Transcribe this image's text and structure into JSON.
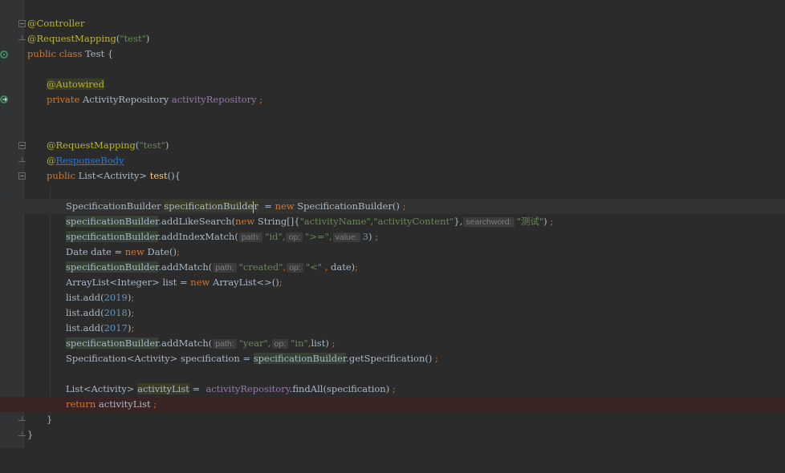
{
  "editor": {
    "lines": {
      "l1": "@Controller",
      "l2a": "@RequestMapping",
      "l2b": "(",
      "l2c": "\"test\"",
      "l2d": ")",
      "l3a": "public class ",
      "l3b": "Test {",
      "l5": "@Autowired",
      "l6a": "private ",
      "l6b": "ActivityRepository ",
      "l6c": "activityRepository",
      "l6d": " ;",
      "l9a": "@RequestMapping",
      "l9b": "(",
      "l9c": "\"test\"",
      "l9d": ")",
      "l10a": "@",
      "l10b": "ResponseBody",
      "l11a": "public ",
      "l11b": "List<Activity> ",
      "l11c": "test",
      "l11d": "(){",
      "l13a": "SpecificationBuilder ",
      "l13b": "specificationBuilde",
      "l13c": "r",
      "l13d": "  = ",
      "l13e": "new ",
      "l13f": "SpecificationBuilder() ",
      "l13g": ";",
      "l14a": "specificationBuilder",
      "l14b": ".addLikeSearch(",
      "l14c": "new ",
      "l14d": "String[]{",
      "l14e": "\"activityName\"",
      "l14f": ",",
      "l14g": "\"activityContent\"",
      "l14h": "},",
      "l14hint": "searchword:",
      "l14i": "\"测试\"",
      "l14j": ") ",
      "l14k": ";",
      "l15a": "specificationBuilder",
      "l15b": ".addIndexMatch(",
      "l15hint1": "path:",
      "l15c": "\"id\"",
      "l15d": ",",
      "l15hint2": "op:",
      "l15e": "\">=\"",
      "l15f": ",",
      "l15hint3": "value:",
      "l15g": "3",
      "l15h": ") ",
      "l15i": ";",
      "l16a": "Date date = ",
      "l16b": "new ",
      "l16c": "Date()",
      "l16d": ";",
      "l17a": "specificationBuilder",
      "l17b": ".addMatch(",
      "l17hint1": "path:",
      "l17c": "\"created\"",
      "l17d": ",",
      "l17hint2": "op:",
      "l17e": "\"<\"",
      "l17f": " , ",
      "l17g": "date)",
      "l17h": ";",
      "l18a": "ArrayList<Integer> list = ",
      "l18b": "new ",
      "l18c": "ArrayList<>()",
      "l18d": ";",
      "l19a": "list.add(",
      "l19b": "2019",
      "l19c": ")",
      "l19d": ";",
      "l20a": "list.add(",
      "l20b": "2018",
      "l20c": ")",
      "l20d": ";",
      "l21a": "list.add(",
      "l21b": "2017",
      "l21c": ")",
      "l21d": ";",
      "l22a": "specificationBuilder",
      "l22b": ".addMatch(",
      "l22hint1": "path:",
      "l22c": "\"year\"",
      "l22d": ",",
      "l22hint2": "op:",
      "l22e": "\"in\"",
      "l22f": ",",
      "l22g": "list) ",
      "l22h": ";",
      "l23a": "Specification<Activity> specification = ",
      "l23b": "specificationBuilder",
      "l23c": ".getSpecification() ",
      "l23d": ";",
      "l25a": "List<Activity> ",
      "l25b": "activityList",
      "l25c": " =  ",
      "l25d": "activityRepository",
      "l25e": ".findAll(specification) ",
      "l25f": ";",
      "l26a": "return ",
      "l26b": "activityList ",
      "l26c": ";",
      "l27": "}",
      "l28": "}"
    },
    "colors": {
      "background": "#2b2b2b",
      "keyword": "#cc7832",
      "annotation": "#bbb529",
      "string": "#6a8759",
      "number": "#6897bb",
      "field": "#9876aa",
      "method": "#ffc66d",
      "text": "#a9b7c6",
      "breakpoint": "#c75450"
    },
    "icons": [
      "spring-bean-icon",
      "autowired-navigate-icon",
      "breakpoint-icon",
      "fold-icon"
    ]
  }
}
